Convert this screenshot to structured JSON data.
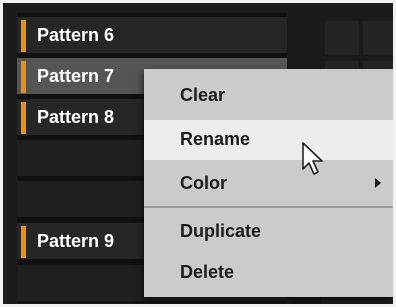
{
  "patterns": [
    {
      "label": "Pattern 6",
      "selected": false
    },
    {
      "label": "Pattern 7",
      "selected": true
    },
    {
      "label": "Pattern 8",
      "selected": false
    },
    {
      "label": "Pattern 9",
      "selected": false
    }
  ],
  "context_menu": {
    "items": [
      {
        "label": "Clear",
        "highlighted": false
      },
      {
        "label": "Rename",
        "highlighted": true
      },
      {
        "label": "Color",
        "highlighted": false,
        "submenu": true
      },
      {
        "label": "Duplicate",
        "highlighted": false
      },
      {
        "label": "Delete",
        "highlighted": false
      }
    ],
    "submenu_icon": "chevron-right-icon"
  },
  "cursor_icon": "mouse-pointer-icon",
  "colors": {
    "pattern_accent": "#e8901a",
    "selected_row": "#555555",
    "menu_background": "#cbcbcb",
    "menu_highlight": "#ececec"
  }
}
